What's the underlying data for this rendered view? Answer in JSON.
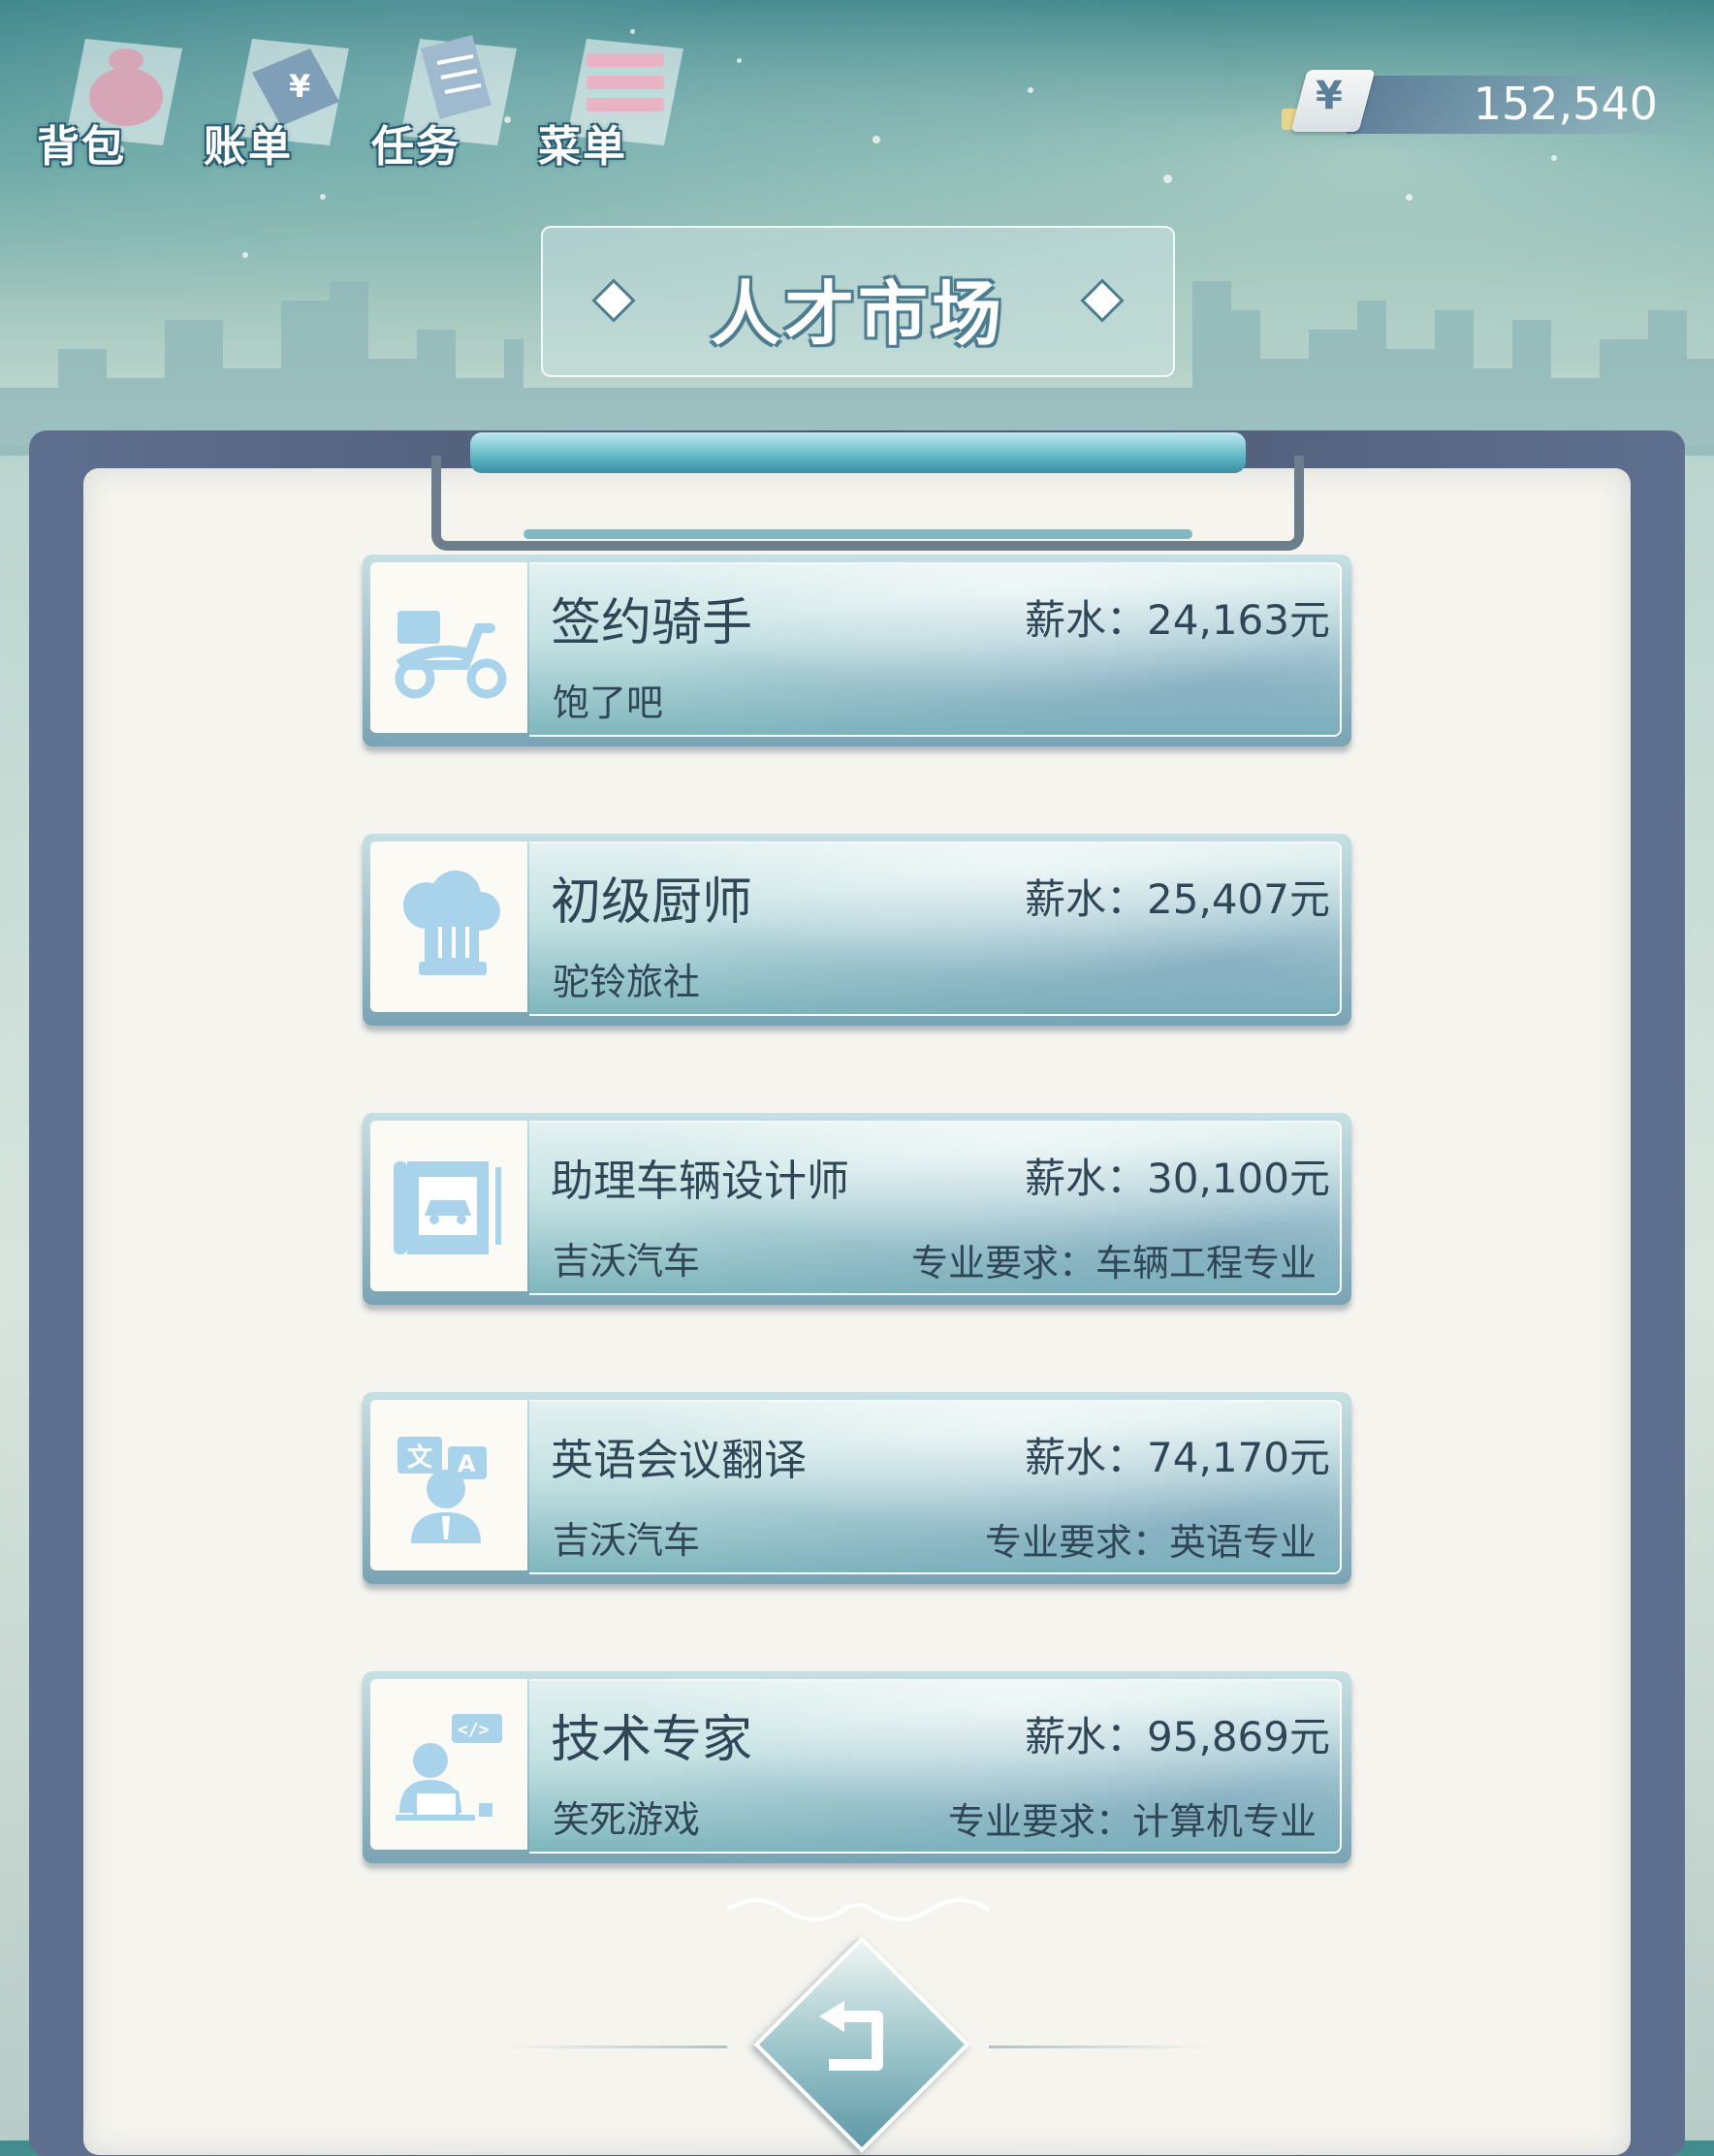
{
  "nav": {
    "items": [
      {
        "label": "背包",
        "icon": "bag-icon"
      },
      {
        "label": "账单",
        "icon": "bill-icon"
      },
      {
        "label": "任务",
        "icon": "task-icon"
      },
      {
        "label": "菜单",
        "icon": "menu-icon"
      }
    ]
  },
  "wallet": {
    "currency_symbol": "¥",
    "balance": "152,540"
  },
  "page": {
    "title": "人才市场"
  },
  "jobs": [
    {
      "title": "签约骑手",
      "salary": "薪水：24,163元",
      "company": "饱了吧",
      "requirement": "",
      "icon": "scooter-icon"
    },
    {
      "title": "初级厨师",
      "salary": "薪水：25,407元",
      "company": "驼铃旅社",
      "requirement": "",
      "icon": "chef-hat-icon"
    },
    {
      "title": "助理车辆设计师",
      "salary": "薪水：30,100元",
      "company": "吉沃汽车",
      "requirement": "专业要求：车辆工程专业",
      "icon": "car-blueprint-icon"
    },
    {
      "title": "英语会议翻译",
      "salary": "薪水：74,170元",
      "company": "吉沃汽车",
      "requirement": "专业要求：英语专业",
      "icon": "translator-icon"
    },
    {
      "title": "技术专家",
      "salary": "薪水：95,869元",
      "company": "笑死游戏",
      "requirement": "专业要求：计算机专业",
      "icon": "programmer-icon"
    }
  ],
  "back_button": {
    "icon": "back-arrow-icon"
  },
  "colors": {
    "accent": "#5fb7c4",
    "text": "#2f4656",
    "icon": "#a9d3ea"
  }
}
